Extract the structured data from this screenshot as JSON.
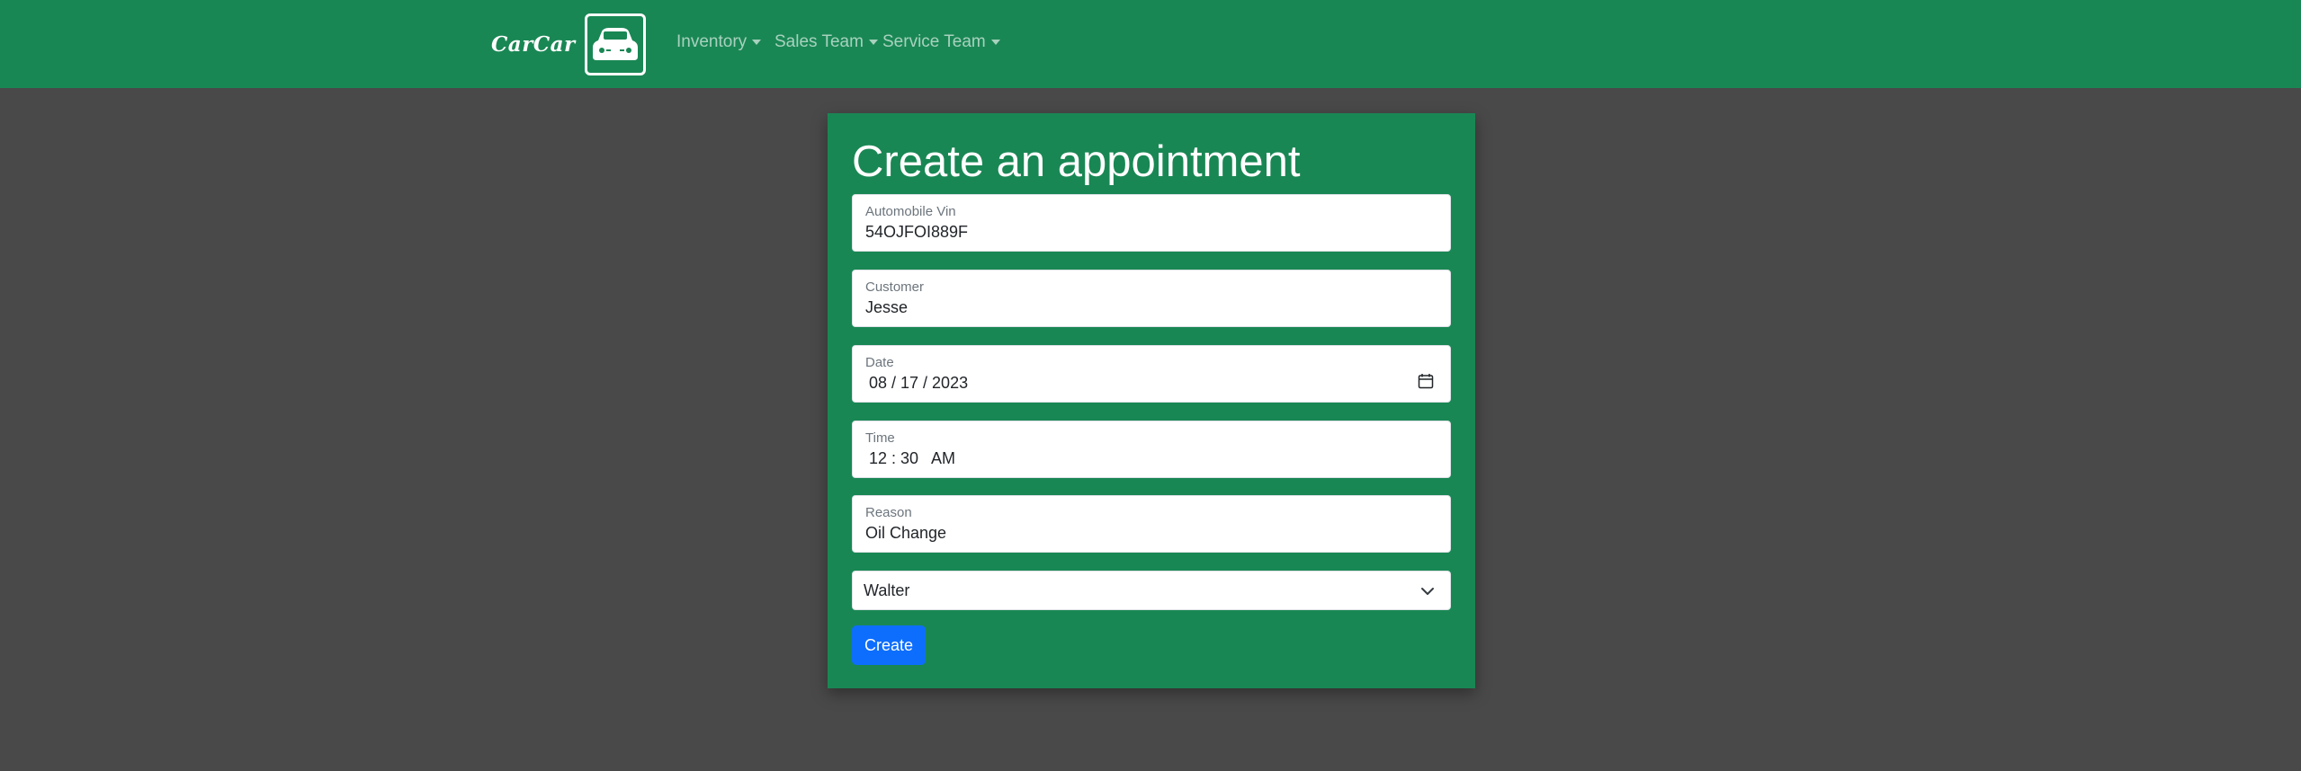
{
  "navbar": {
    "brand": "CarCar",
    "items": [
      {
        "label": "Inventory"
      },
      {
        "label": "Sales Team"
      },
      {
        "label": "Service Team"
      }
    ],
    "color": "#198754"
  },
  "form": {
    "title": "Create an appointment",
    "fields": [
      {
        "label": "Automobile Vin",
        "value": "54OJFOI889F"
      },
      {
        "label": "Customer",
        "value": "Jesse"
      },
      {
        "label": "Date",
        "value": "08 / 17 / 2023",
        "icon": "calendar-icon"
      },
      {
        "label": "Time",
        "value": "12 : 30   AM"
      },
      {
        "label": "Reason",
        "value": "Oil Change"
      }
    ],
    "technician": {
      "selected": "Walter",
      "icon": "chevron-down-icon"
    },
    "submit_label": "Create",
    "submit_color": "#0d6efd"
  }
}
